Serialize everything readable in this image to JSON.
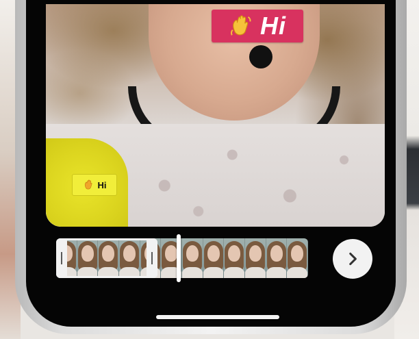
{
  "sticker": {
    "label": "Hi",
    "icon": "waving-hand-icon",
    "background_color": "#d8325f"
  },
  "sticker_preview": {
    "label": "Hi",
    "icon": "waving-hand-icon",
    "highlight_color": "#e9e42a"
  },
  "timeline": {
    "frame_count": 12
  },
  "controls": {
    "next_icon": "chevron-right-icon"
  }
}
